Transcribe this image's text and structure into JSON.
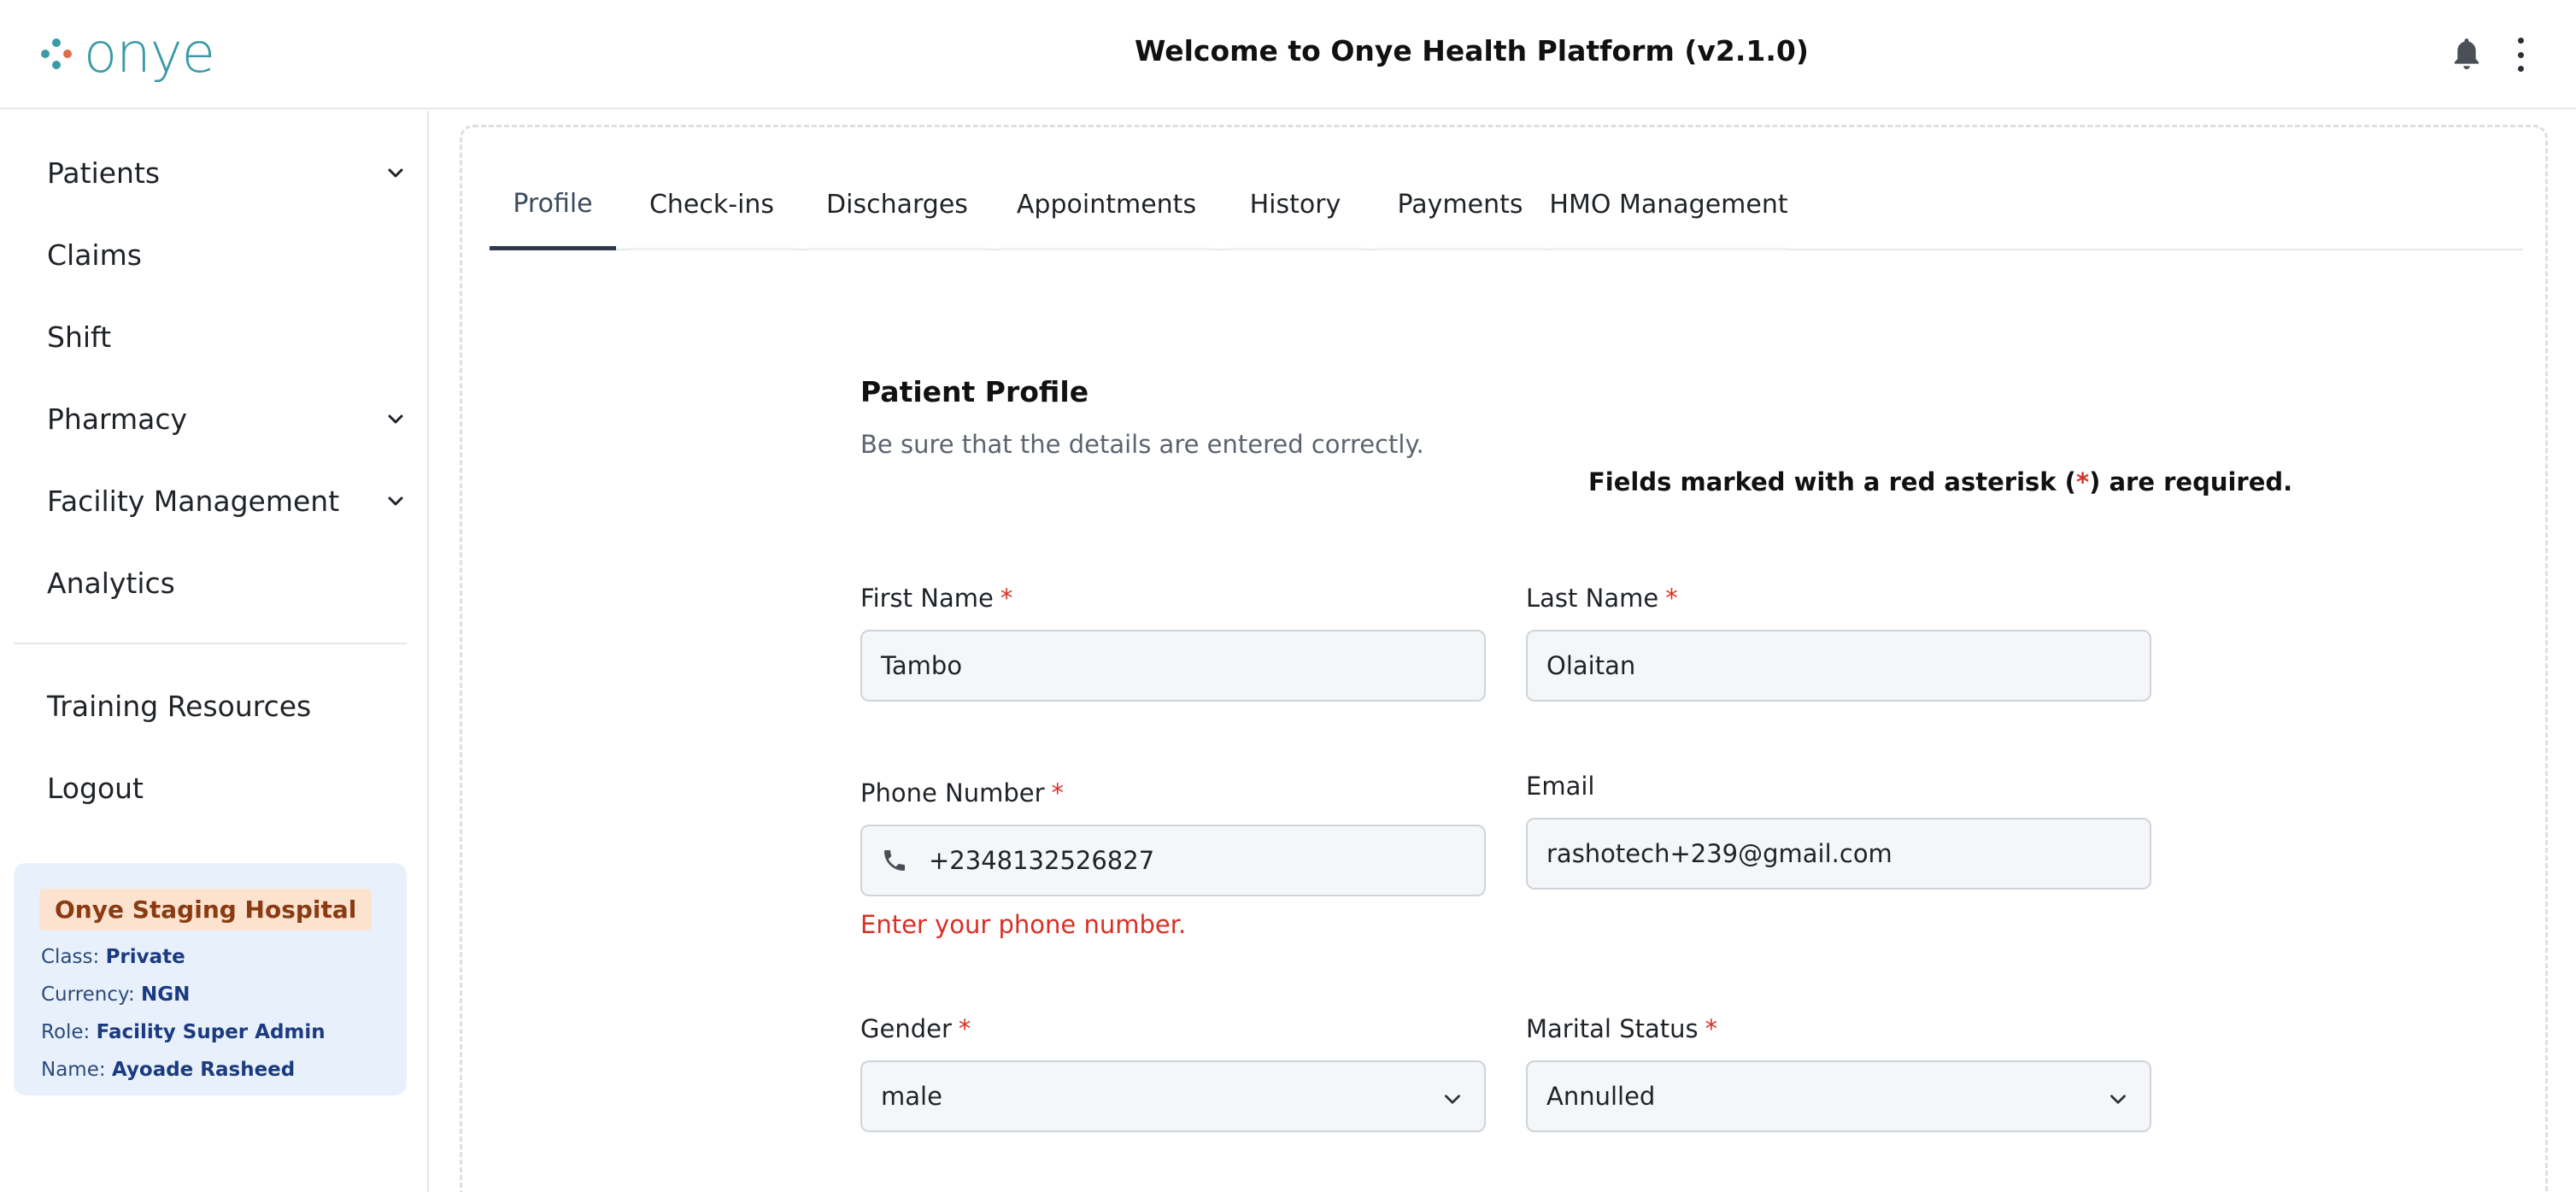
{
  "header": {
    "logo_text": "onye",
    "title": "Welcome to Onye Health Platform (v2.1.0)",
    "icons": {
      "notifications": "bell-icon",
      "more": "more-vertical-icon"
    }
  },
  "sidebar": {
    "items": [
      {
        "label": "Patients",
        "has_chevron": true
      },
      {
        "label": "Claims",
        "has_chevron": false
      },
      {
        "label": "Shift",
        "has_chevron": false
      },
      {
        "label": "Pharmacy",
        "has_chevron": true
      },
      {
        "label": "Facility Management",
        "has_chevron": true
      },
      {
        "label": "Analytics",
        "has_chevron": false
      }
    ],
    "secondary": [
      {
        "label": "Training Resources"
      },
      {
        "label": "Logout"
      }
    ],
    "facility": {
      "name": "Onye Staging Hospital",
      "class_label": "Class:",
      "class_value": "Private",
      "currency_label": "Currency:",
      "currency_value": "NGN",
      "role_label": "Role:",
      "role_value": "Facility Super Admin",
      "user_label": "Name:",
      "user_value": "Ayoade Rasheed"
    }
  },
  "tabs": [
    {
      "label": "Profile",
      "active": true
    },
    {
      "label": "Check-ins",
      "active": false
    },
    {
      "label": "Discharges",
      "active": false
    },
    {
      "label": "Appointments",
      "active": false
    },
    {
      "label": "History",
      "active": false
    },
    {
      "label": "Payments",
      "active": false
    },
    {
      "label": "HMO Management",
      "active": false
    }
  ],
  "form": {
    "title": "Patient Profile",
    "subtitle": "Be sure that the details are entered correctly.",
    "required_note_pre": "Fields marked with a red asterisk (",
    "required_note_ast": "*",
    "required_note_post": ") are required.",
    "first_name": {
      "label": "First Name",
      "value": "Tambo",
      "required": "*"
    },
    "last_name": {
      "label": "Last Name",
      "value": "Olaitan",
      "required": "*"
    },
    "phone": {
      "label": "Phone Number",
      "value": "+2348132526827",
      "required": "*",
      "error": "Enter your phone number."
    },
    "email": {
      "label": "Email",
      "value": "rashotech+239@gmail.com"
    },
    "gender": {
      "label": "Gender",
      "value": "male",
      "required": "*"
    },
    "marital_status": {
      "label": "Marital Status",
      "value": "Annulled",
      "required": "*"
    }
  },
  "colors": {
    "brand": "#3a9aa6",
    "error": "#d93025",
    "facility_card_bg": "#e8f1fb",
    "facility_badge_bg": "#fbe3d0"
  }
}
